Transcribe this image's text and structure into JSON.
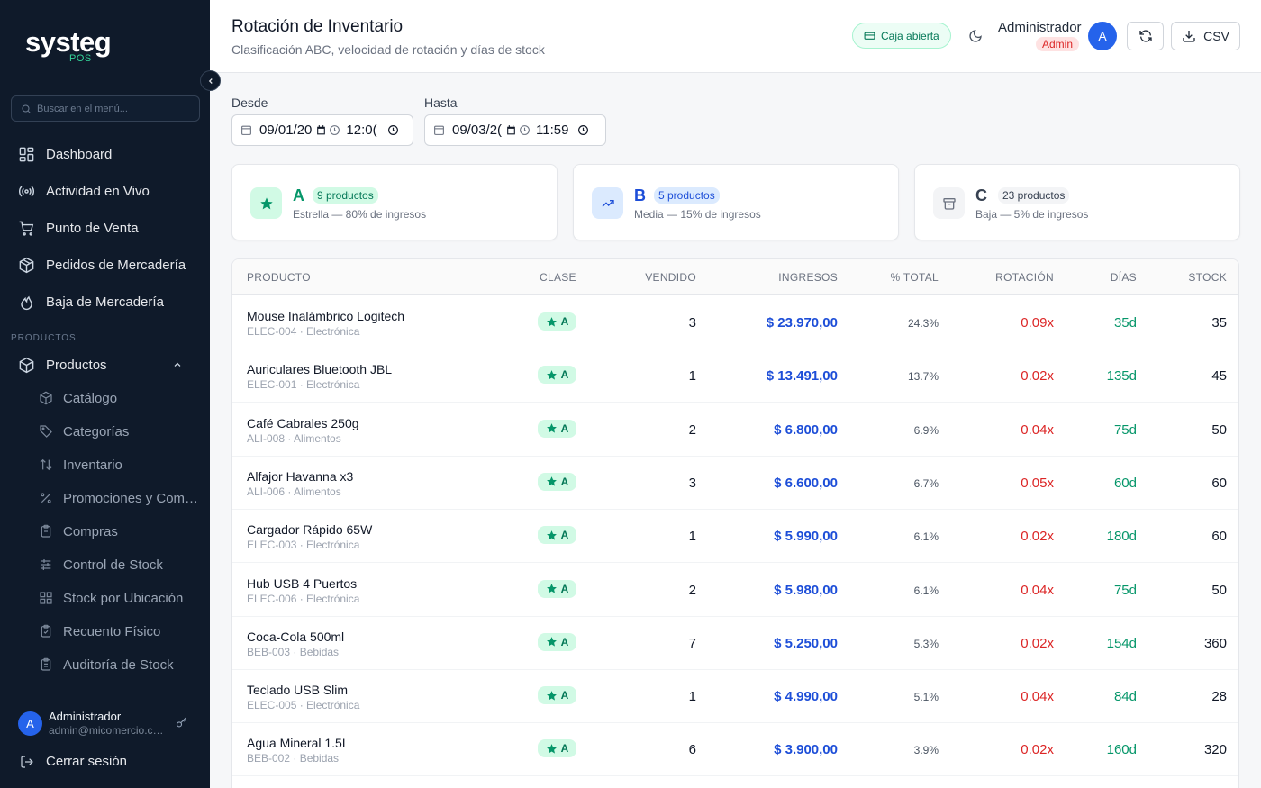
{
  "sidebar": {
    "brand": "systeg",
    "brand_sub": "POS",
    "search_placeholder": "Buscar en el menú...",
    "nav": [
      {
        "label": "Dashboard",
        "icon": "grid-icon"
      },
      {
        "label": "Actividad en Vivo",
        "icon": "radio-icon"
      },
      {
        "label": "Punto de Venta",
        "icon": "cart-icon"
      },
      {
        "label": "Pedidos de Mercadería",
        "icon": "package-icon"
      },
      {
        "label": "Baja de Mercadería",
        "icon": "flame-icon"
      }
    ],
    "section_label": "PRODUCTOS",
    "products_label": "Productos",
    "sub_items": [
      {
        "label": "Catálogo",
        "icon": "box-icon"
      },
      {
        "label": "Categorías",
        "icon": "tag-icon"
      },
      {
        "label": "Inventario",
        "icon": "arrows-updown-icon"
      },
      {
        "label": "Promociones y Combos",
        "icon": "percent-icon"
      },
      {
        "label": "Compras",
        "icon": "clipboard-icon"
      },
      {
        "label": "Control de Stock",
        "icon": "sliders-icon"
      },
      {
        "label": "Stock por Ubicación",
        "icon": "grid-icon"
      },
      {
        "label": "Recuento Físico",
        "icon": "clipboard-check-icon"
      },
      {
        "label": "Auditoría de Stock",
        "icon": "clipboard-list-icon"
      }
    ],
    "user": {
      "initial": "A",
      "name": "Administrador",
      "email": "admin@micomercio.com"
    },
    "logout_label": "Cerrar sesión"
  },
  "header": {
    "title": "Rotación de Inventario",
    "subtitle": "Clasificación ABC, velocidad de rotación y días de stock",
    "caja_label": "Caja abierta",
    "admin_name": "Administrador",
    "admin_role": "Admin",
    "admin_initial": "A",
    "csv_label": "CSV"
  },
  "filters": {
    "desde_label": "Desde",
    "desde_date": "09/01/20",
    "desde_time": "12:0(",
    "hasta_label": "Hasta",
    "hasta_date": "09/03/2(",
    "hasta_time": "11:59"
  },
  "cards": [
    {
      "letter": "A",
      "count": "9 productos",
      "desc": "Estrella — 80% de ingresos",
      "color": "#059669",
      "pill_bg": "#d1fae5",
      "pill_fg": "#047857",
      "icon_bg": "#d1fae5",
      "icon": "star-icon"
    },
    {
      "letter": "B",
      "count": "5 productos",
      "desc": "Media — 15% de ingresos",
      "color": "#1d4ed8",
      "pill_bg": "#dbeafe",
      "pill_fg": "#1d4ed8",
      "icon_bg": "#dbeafe",
      "icon": "trending-up-icon"
    },
    {
      "letter": "C",
      "count": "23 productos",
      "desc": "Baja — 5% de ingresos",
      "color": "#374151",
      "pill_bg": "#f3f4f6",
      "pill_fg": "#374151",
      "icon_bg": "#f3f4f6",
      "icon": "archive-icon"
    }
  ],
  "table": {
    "headers": {
      "producto": "PRODUCTO",
      "clase": "CLASE",
      "vendido": "VENDIDO",
      "ingresos": "INGRESOS",
      "total": "% TOTAL",
      "rotacion": "ROTACIÓN",
      "dias": "DÍAS",
      "stock": "STOCK"
    },
    "rows": [
      {
        "name": "Mouse Inalámbrico Logitech",
        "sub": "ELEC-004 · Electrónica",
        "clase": "A",
        "vendido": "3",
        "ingresos": "$ 23.970,00",
        "pct": "24.3%",
        "rot": "0.09x",
        "dias": "35d",
        "stock": "35"
      },
      {
        "name": "Auriculares Bluetooth JBL",
        "sub": "ELEC-001 · Electrónica",
        "clase": "A",
        "vendido": "1",
        "ingresos": "$ 13.491,00",
        "pct": "13.7%",
        "rot": "0.02x",
        "dias": "135d",
        "stock": "45"
      },
      {
        "name": "Café Cabrales 250g",
        "sub": "ALI-008 · Alimentos",
        "clase": "A",
        "vendido": "2",
        "ingresos": "$ 6.800,00",
        "pct": "6.9%",
        "rot": "0.04x",
        "dias": "75d",
        "stock": "50"
      },
      {
        "name": "Alfajor Havanna x3",
        "sub": "ALI-006 · Alimentos",
        "clase": "A",
        "vendido": "3",
        "ingresos": "$ 6.600,00",
        "pct": "6.7%",
        "rot": "0.05x",
        "dias": "60d",
        "stock": "60"
      },
      {
        "name": "Cargador Rápido 65W",
        "sub": "ELEC-003 · Electrónica",
        "clase": "A",
        "vendido": "1",
        "ingresos": "$ 5.990,00",
        "pct": "6.1%",
        "rot": "0.02x",
        "dias": "180d",
        "stock": "60"
      },
      {
        "name": "Hub USB 4 Puertos",
        "sub": "ELEC-006 · Electrónica",
        "clase": "A",
        "vendido": "2",
        "ingresos": "$ 5.980,00",
        "pct": "6.1%",
        "rot": "0.04x",
        "dias": "75d",
        "stock": "50"
      },
      {
        "name": "Coca-Cola 500ml",
        "sub": "BEB-003 · Bebidas",
        "clase": "A",
        "vendido": "7",
        "ingresos": "$ 5.250,00",
        "pct": "5.3%",
        "rot": "0.02x",
        "dias": "154d",
        "stock": "360"
      },
      {
        "name": "Teclado USB Slim",
        "sub": "ELEC-005 · Electrónica",
        "clase": "A",
        "vendido": "1",
        "ingresos": "$ 4.990,00",
        "pct": "5.1%",
        "rot": "0.04x",
        "dias": "84d",
        "stock": "28"
      },
      {
        "name": "Agua Mineral 1.5L",
        "sub": "BEB-002 · Bebidas",
        "clase": "A",
        "vendido": "6",
        "ingresos": "$ 3.900,00",
        "pct": "3.9%",
        "rot": "0.02x",
        "dias": "160d",
        "stock": "320"
      }
    ]
  }
}
